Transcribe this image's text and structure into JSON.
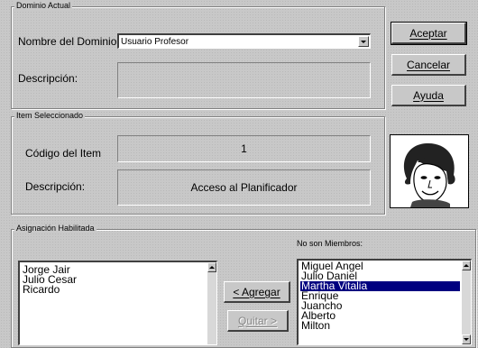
{
  "dominio": {
    "title": "Dominio Actual",
    "nombre_label": "Nombre del Dominio:",
    "nombre_value": "Usuario Profesor",
    "descripcion_label": "Descripción:",
    "descripcion_value": ""
  },
  "buttons": {
    "aceptar": "Aceptar",
    "cancelar": "Cancelar",
    "ayuda": "Ayuda",
    "agregar": "< Agregar",
    "quitar": "Quitar >"
  },
  "item": {
    "title": "Item Seleccionado",
    "codigo_label": "Código del Item",
    "codigo_value": "1",
    "descripcion_label": "Descripción:",
    "descripcion_value": "Acceso al Planificador"
  },
  "asignacion": {
    "title": "Asignación Habilitada",
    "members": [
      "Jorge Jair",
      "Julio Cesar",
      "Ricardo"
    ],
    "non_members_label": "No son Miembros:",
    "non_members": [
      "Miguel Angel",
      "Julio Daniel",
      "Martha Vitalia",
      "Enrique",
      "Juancho",
      "Alberto",
      "Milton"
    ],
    "selected_non_member": "Martha Vitalia"
  },
  "colors": {
    "selection": "#000080",
    "face": "#c8c8c8"
  }
}
